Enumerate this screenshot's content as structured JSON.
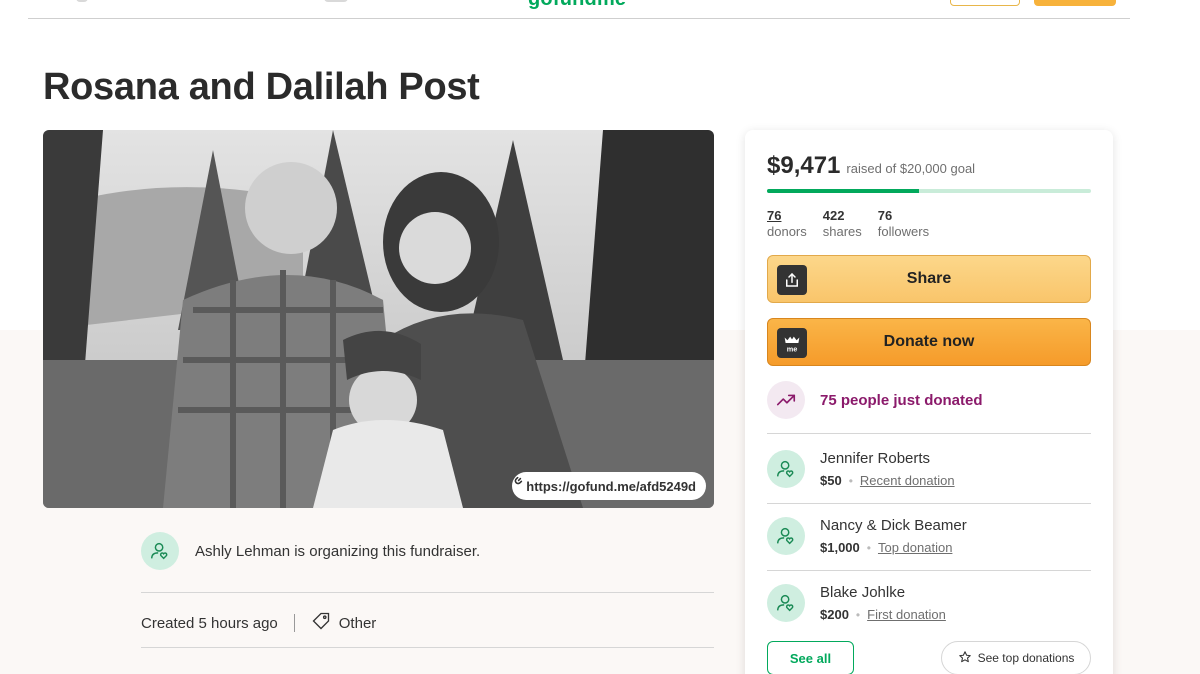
{
  "nav": {
    "logo": "gofundme"
  },
  "campaign": {
    "title": "Rosana and Dalilah Post",
    "short_url": "https://gofund.me/afd5249d",
    "organizer_text": "Ashly Lehman is organizing this fundraiser.",
    "created": "Created 5 hours ago",
    "category": "Other"
  },
  "card": {
    "raised": "$9,471",
    "goal_text": "raised of $20,000 goal",
    "progress_fraction": 0.47,
    "stats": [
      {
        "value": "76",
        "label": "donors"
      },
      {
        "value": "422",
        "label": "shares"
      },
      {
        "value": "76",
        "label": "followers"
      }
    ],
    "share_label": "Share",
    "donate_label": "Donate now",
    "donate_icon_text": "me",
    "trend_text": "75 people just donated",
    "donations": [
      {
        "name": "Jennifer Roberts",
        "amount": "$50",
        "type": "Recent donation"
      },
      {
        "name": "Nancy & Dick Beamer",
        "amount": "$1,000",
        "type": "Top donation"
      },
      {
        "name": "Blake Johlke",
        "amount": "$200",
        "type": "First donation"
      }
    ],
    "see_all_label": "See all",
    "see_top_label": "See top donations"
  },
  "colors": {
    "brand_green": "#02a95c",
    "donate_orange": "#f59b2a",
    "share_yellow": "#fcd78a",
    "trend_purple": "#8b1a6b"
  }
}
